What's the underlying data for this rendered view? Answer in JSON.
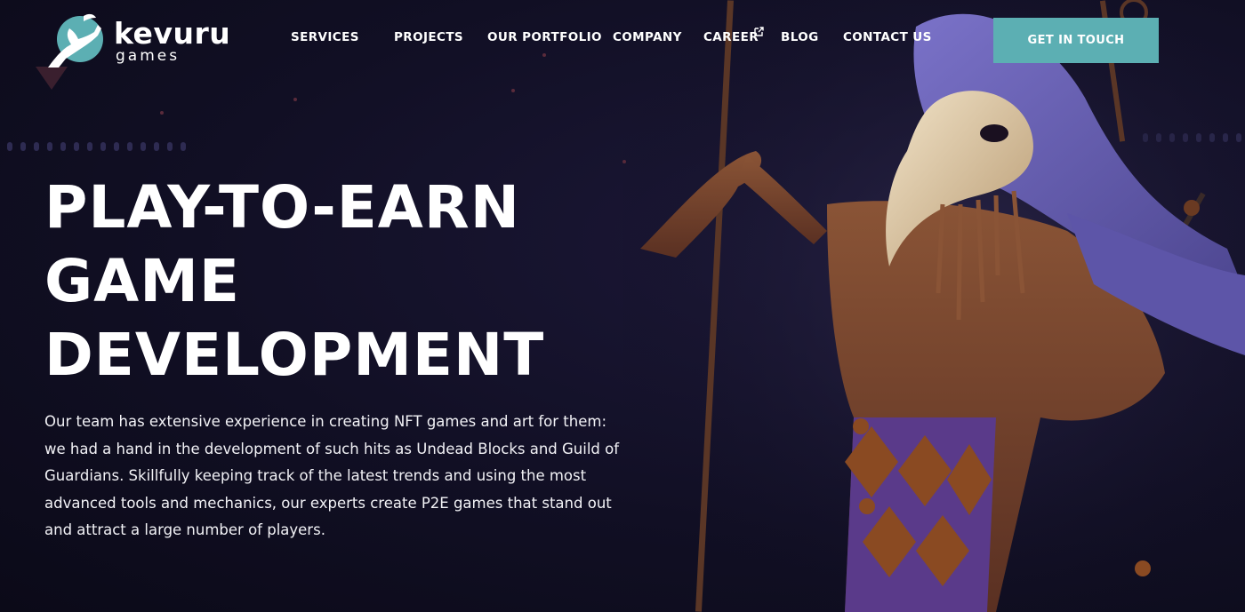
{
  "brand": {
    "name": "kevuru",
    "sub": "games",
    "accent": "#5cafb3"
  },
  "nav": {
    "items": [
      {
        "label": "SERVICES",
        "name": "nav-services"
      },
      {
        "label": "PROJECTS",
        "name": "nav-projects"
      },
      {
        "label": "OUR PORTFOLIO",
        "name": "nav-our-portfolio"
      },
      {
        "label": "COMPANY",
        "name": "nav-company"
      },
      {
        "label": "CAREER",
        "name": "nav-career",
        "icon": "external-link-icon"
      },
      {
        "label": "BLOG",
        "name": "nav-blog"
      },
      {
        "label": "CONTACT US",
        "name": "nav-contact-us"
      }
    ],
    "cta_label": "GET IN TOUCH"
  },
  "hero": {
    "title_lines": [
      "PLAY-TO-EARN",
      "GAME",
      "DEVELOPMENT"
    ],
    "description": "Our team has extensive experience in creating NFT games and art for them: we had a hand in the development of such hits as Undead Blocks and Guild of Guardians. Skillfully keeping track of the latest trends and using the most advanced tools and mechanics, our experts create P2E games that stand out and attract a large number of players.",
    "illustration": "plague-doctor-jester-character"
  }
}
